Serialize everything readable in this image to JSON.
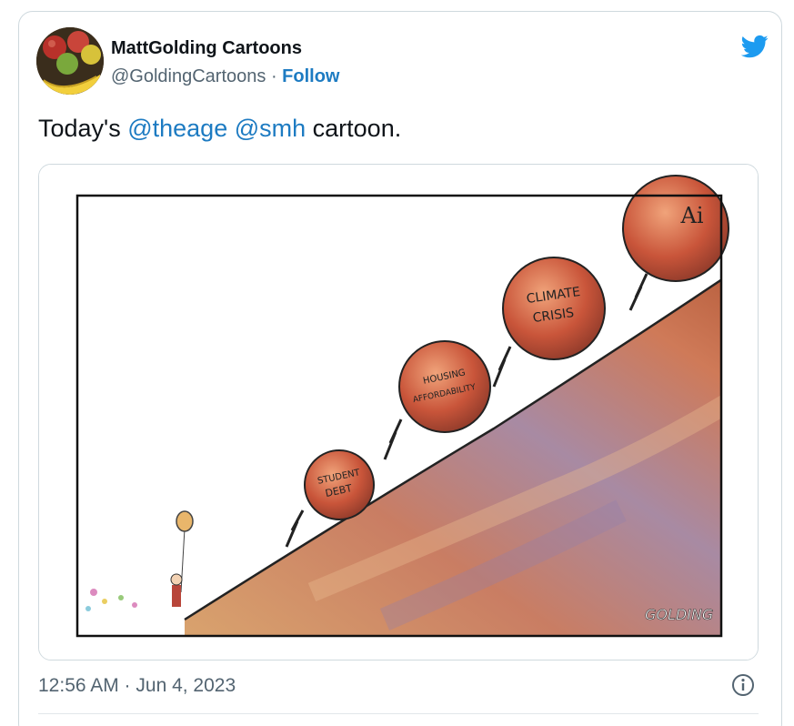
{
  "tweet": {
    "author_name": "MattGolding Cartoons",
    "handle": "@GoldingCartoons",
    "separator": " · ",
    "follow_label": "Follow",
    "text_prefix": "Today's ",
    "mention_1": "@theage",
    "text_space": " ",
    "mention_2": "@smh",
    "text_suffix": " cartoon.",
    "timestamp": "12:56 AM · Jun 4, 2023"
  },
  "cartoon": {
    "boulder_labels": {
      "student_debt_1": "STUDENT",
      "student_debt_2": "DEBT",
      "housing_1": "HOUSING",
      "housing_2": "AFFORDABILITY",
      "climate_1": "CLIMATE",
      "climate_2": "CRISIS",
      "ai": "Ai"
    },
    "signature": "GOLDING"
  },
  "colors": {
    "accent": "#1d9bf0",
    "link": "#1d7bc2",
    "secondary_text": "#536471",
    "border": "#cfd9de"
  },
  "icons": {
    "logo": "twitter-bird-icon",
    "info": "info-icon"
  }
}
